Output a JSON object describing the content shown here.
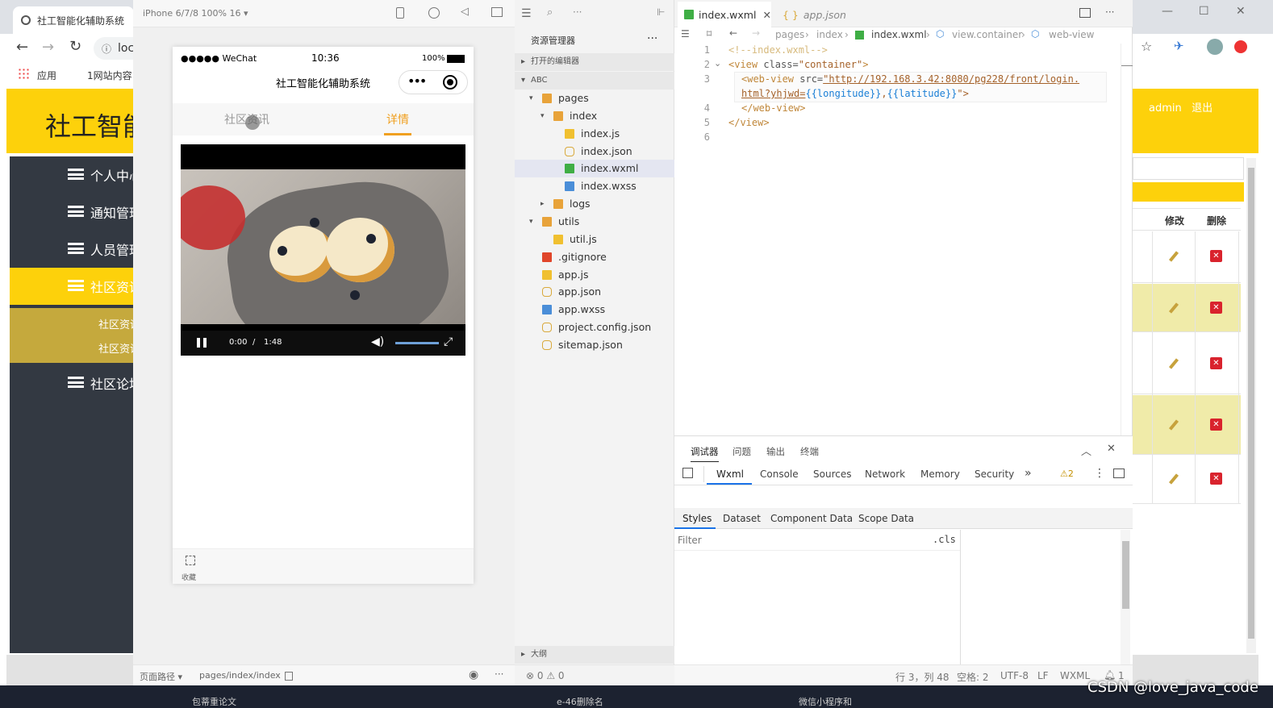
{
  "browser": {
    "tab_title": "社工智能化辅助系统",
    "address": "loc",
    "bookmarks": {
      "apps": "应用",
      "site": "1网站内容"
    },
    "site_title": "社工智能",
    "admin": "admin",
    "logout": "退出",
    "sidebar": [
      {
        "label": "个人中心"
      },
      {
        "label": "通知管理"
      },
      {
        "label": "人员管理"
      },
      {
        "label": "社区资讯"
      },
      {
        "label": "社区论坛"
      }
    ],
    "submenu": [
      "社区资讯",
      "社区资讯"
    ],
    "table_headers": {
      "edit": "修改",
      "delete": "删除"
    },
    "taskbar": [
      "包蒂重论文",
      "e-46删除名",
      "微信小程序和"
    ]
  },
  "simulator": {
    "device": "iPhone 6/7/8 100% 16 ▾",
    "status": {
      "carrier": "●●●●● WeChat",
      "time": "10:36",
      "battery": "100%"
    },
    "nav_title": "社工智能化辅助系统",
    "tabs": [
      "社区资讯",
      "详情"
    ],
    "active_tab": 1,
    "video": {
      "current": "0:00",
      "separator": "/",
      "duration": "1:48"
    },
    "bottom_label": "收藏",
    "footer": {
      "path_label": "页面路径 ▾",
      "path": "pages/index/index"
    }
  },
  "explorer": {
    "title": "资源管理器",
    "open_editors": "打开的编辑器",
    "project": "ABC",
    "outline": "大纲",
    "tree": [
      {
        "label": "pages",
        "depth": 1,
        "type": "folder",
        "arrow": "▾"
      },
      {
        "label": "index",
        "depth": 2,
        "type": "folder",
        "arrow": "▾"
      },
      {
        "label": "index.js",
        "depth": 3,
        "type": "js"
      },
      {
        "label": "index.json",
        "depth": 3,
        "type": "json"
      },
      {
        "label": "index.wxml",
        "depth": 3,
        "type": "wxml"
      },
      {
        "label": "index.wxss",
        "depth": 3,
        "type": "wxss"
      },
      {
        "label": "logs",
        "depth": 2,
        "type": "folder",
        "arrow": "▸"
      },
      {
        "label": "utils",
        "depth": 1,
        "type": "folder",
        "arrow": "▾"
      },
      {
        "label": "util.js",
        "depth": 2,
        "type": "js"
      },
      {
        "label": ".gitignore",
        "depth": 1,
        "type": "git"
      },
      {
        "label": "app.js",
        "depth": 1,
        "type": "js"
      },
      {
        "label": "app.json",
        "depth": 1,
        "type": "json"
      },
      {
        "label": "app.wxss",
        "depth": 1,
        "type": "wxss"
      },
      {
        "label": "project.config.json",
        "depth": 1,
        "type": "json"
      },
      {
        "label": "sitemap.json",
        "depth": 1,
        "type": "json"
      }
    ],
    "selected": 4,
    "footer": "⊗ 0 ⚠ 0"
  },
  "editor": {
    "tabs": [
      "index.wxml",
      "app.json"
    ],
    "breadcrumb": [
      "pages",
      "index",
      "index.wxml",
      "view.container",
      "web-view"
    ],
    "lines": [
      "1",
      "2",
      "3",
      "",
      "4",
      "5",
      "6"
    ],
    "code": {
      "l1": "<!--index.wxml-->",
      "l2a": "<view ",
      "l2b": "class=",
      "l2c": "\"container\"",
      "l2d": ">",
      "l3a": "<web-view ",
      "l3b": "src=",
      "l3c": "\"http://192.168.3.42:8080/pg228/front/login.",
      "l3d": "html?yhjwd=",
      "l3e": "{{longitude}}",
      "l3f": ",",
      "l3g": "{{latitude}}",
      "l3h": "\">",
      "l4": "</web-view>",
      "l5": "</view>"
    },
    "footer": {
      "pos": "行 3，列 48",
      "spaces": "空格: 2",
      "enc": "UTF-8",
      "eol": "LF",
      "lang": "WXML",
      "bell": "1"
    }
  },
  "debugger": {
    "tabs": [
      "调试器",
      "问题",
      "输出",
      "终端"
    ],
    "tools": [
      "Wxml",
      "Console",
      "Sources",
      "Network",
      "Memory",
      "Security"
    ],
    "more": "»",
    "warnings": "⚠2",
    "subtabs": [
      "Styles",
      "Dataset",
      "Component Data",
      "Scope Data"
    ],
    "filter_placeholder": "Filter",
    "cls": ".cls"
  },
  "watermark": "CSDN @love_java_code"
}
